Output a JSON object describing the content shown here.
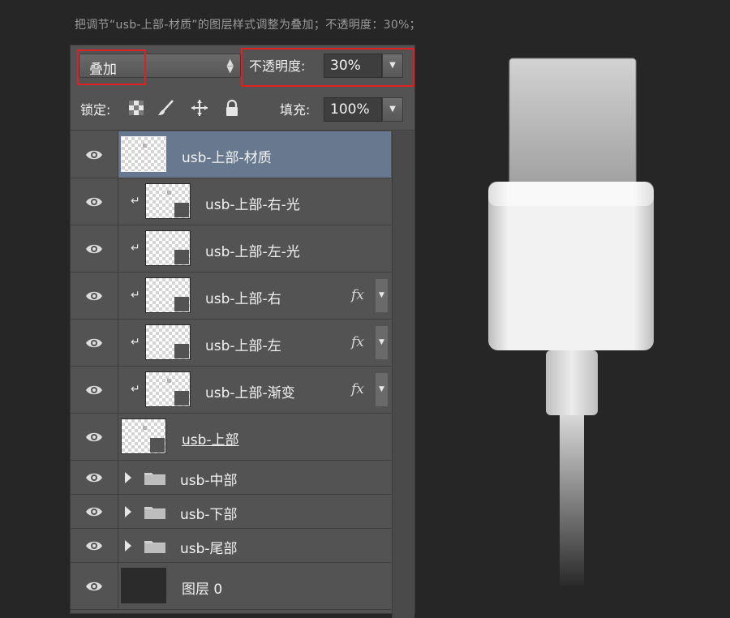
{
  "instruction": "把调节“usb-上部-材质”的图层样式调整为叠加；不透明度：30%；",
  "toolbar": {
    "blend_mode": "叠加",
    "opacity_label": "不透明度:",
    "opacity_value": "30%",
    "lock_label": "锁定:",
    "fill_label": "填充:",
    "fill_value": "100%"
  },
  "layers": [
    {
      "name": "usb-上部-材质",
      "selected": true,
      "clipped": false,
      "fx": false
    },
    {
      "name": "usb-上部-右-光",
      "clipped": true,
      "fx": false
    },
    {
      "name": "usb-上部-左-光",
      "clipped": true,
      "fx": false
    },
    {
      "name": "usb-上部-右",
      "clipped": true,
      "fx": true
    },
    {
      "name": "usb-上部-左",
      "clipped": true,
      "fx": true
    },
    {
      "name": "usb-上部-渐变",
      "clipped": true,
      "fx": true
    },
    {
      "name": "usb-上部",
      "clipped": false,
      "fx": false,
      "underline": true
    },
    {
      "name": "usb-中部",
      "group": true
    },
    {
      "name": "usb-下部",
      "group": true
    },
    {
      "name": "usb-尾部",
      "group": true
    },
    {
      "name": "图层 0",
      "clipped": false
    }
  ],
  "fx_label": "fx",
  "icons": [
    "eye-icon",
    "lock-transparent-icon",
    "brush-icon",
    "move-icon",
    "lock-icon",
    "folder-icon",
    "clip-arrow-icon",
    "dropdown-arrow-icon"
  ],
  "colors": {
    "highlight": "#e02020",
    "selected_row": "#67788f"
  }
}
